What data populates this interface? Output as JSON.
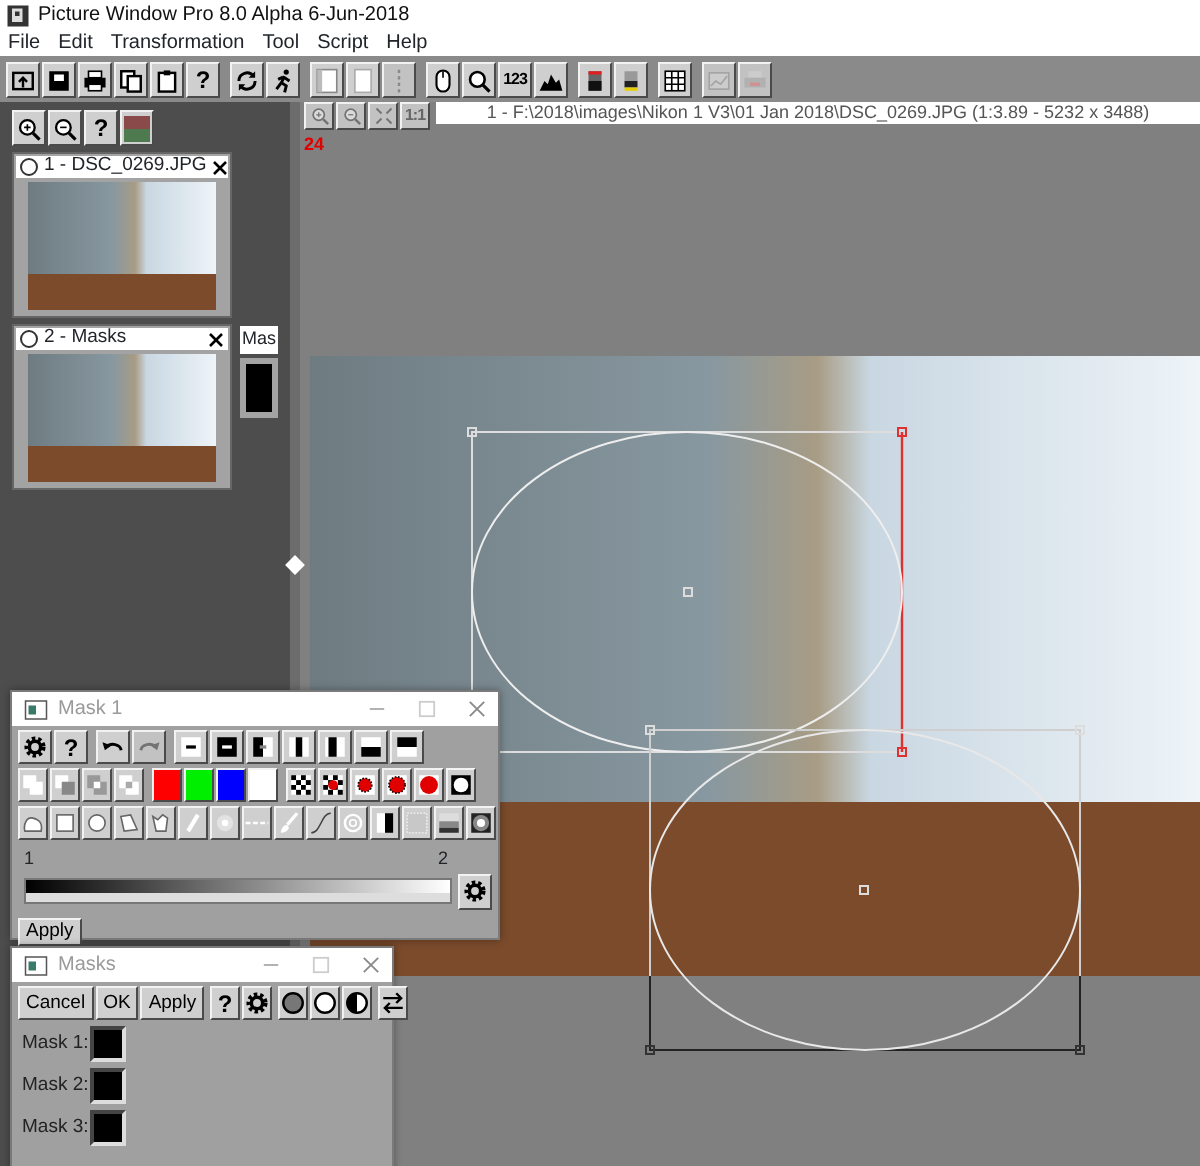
{
  "window": {
    "title": "Picture Window Pro 8.0 Alpha 6-Jun-2018"
  },
  "menu": [
    "File",
    "Edit",
    "Transformation",
    "Tool",
    "Script",
    "Help"
  ],
  "toolbar": [
    [
      {
        "kind": "open",
        "disabled": false
      },
      {
        "kind": "save",
        "disabled": false
      },
      {
        "kind": "print",
        "disabled": false
      },
      {
        "kind": "copy",
        "disabled": false
      },
      {
        "kind": "paste",
        "disabled": false
      },
      {
        "kind": "help",
        "label": "?",
        "disabled": false
      }
    ],
    [
      {
        "kind": "refresh",
        "disabled": false
      },
      {
        "kind": "run",
        "disabled": false
      }
    ],
    [
      {
        "kind": "panel-left",
        "disabled": false
      },
      {
        "kind": "page",
        "disabled": false
      },
      {
        "kind": "dots",
        "disabled": true
      }
    ],
    [
      {
        "kind": "mouse",
        "disabled": false
      },
      {
        "kind": "zoom",
        "disabled": false
      },
      {
        "kind": "numbers",
        "label": "123",
        "disabled": false
      },
      {
        "kind": "mountain",
        "disabled": false
      }
    ],
    [
      {
        "kind": "grad-red",
        "disabled": false
      },
      {
        "kind": "grad-yellow",
        "disabled": false
      }
    ],
    [
      {
        "kind": "grid",
        "disabled": false
      }
    ],
    [
      {
        "kind": "chart",
        "disabled": true
      },
      {
        "kind": "printer",
        "disabled": true
      }
    ]
  ],
  "panel": {
    "toolbar": [
      {
        "kind": "zoom-in",
        "disabled": false
      },
      {
        "kind": "zoom-out",
        "disabled": false
      },
      {
        "kind": "help",
        "label": "?",
        "disabled": false
      },
      {
        "kind": "swatch",
        "disabled": false
      }
    ],
    "thumbnails": [
      {
        "title": "1 - DSC_0269.JPG",
        "selected": false
      },
      {
        "title": "2 - Masks",
        "selected": false
      }
    ],
    "side_tab": {
      "label": "Mas"
    }
  },
  "image_window": {
    "toolbar": [
      {
        "kind": "zoom-in",
        "disabled": true
      },
      {
        "kind": "zoom-out",
        "disabled": true
      },
      {
        "kind": "fit",
        "disabled": true
      },
      {
        "kind": "actual-size",
        "label": "1:1",
        "disabled": true
      }
    ],
    "path": "1 - F:\\2018\\images\\Nikon 1 V3\\01 Jan 2018\\DSC_0269.JPG (1:3.89 - 5232 x 3488)",
    "counter": "24"
  },
  "mask_window": {
    "title": "Mask 1",
    "rows": [
      [
        [
          {
            "kind": "settings",
            "disabled": false
          },
          {
            "kind": "help",
            "label": "?",
            "disabled": false
          }
        ],
        [
          {
            "kind": "undo",
            "disabled": false
          },
          {
            "kind": "redo",
            "disabled": true
          }
        ],
        [
          {
            "kind": "dash",
            "disabled": false
          },
          {
            "kind": "dash-inverse",
            "disabled": false
          },
          {
            "kind": "split-dash",
            "disabled": false
          },
          {
            "kind": "bar-center",
            "disabled": false
          },
          {
            "kind": "bar-left",
            "disabled": false
          },
          {
            "kind": "band-bottom",
            "disabled": false
          },
          {
            "kind": "band-top",
            "disabled": false
          }
        ]
      ],
      [
        [
          {
            "kind": "union",
            "disabled": false
          },
          {
            "kind": "subtract",
            "disabled": false
          },
          {
            "kind": "intersect",
            "disabled": false
          },
          {
            "kind": "exclude",
            "disabled": false
          }
        ],
        [
          {
            "kind": "color",
            "color": "#ff0000"
          },
          {
            "kind": "color",
            "color": "#00ee00"
          },
          {
            "kind": "color",
            "color": "#0000ff"
          },
          {
            "kind": "color",
            "color": "#ffffff"
          }
        ],
        [
          {
            "kind": "checker",
            "disabled": false
          },
          {
            "kind": "checker-red",
            "disabled": false
          },
          {
            "kind": "dots-red-small",
            "disabled": false
          },
          {
            "kind": "dots-red",
            "disabled": false
          },
          {
            "kind": "dot-red",
            "disabled": false
          },
          {
            "kind": "dot-white",
            "disabled": false
          }
        ]
      ],
      [
        [
          {
            "kind": "blob",
            "disabled": false
          },
          {
            "kind": "square",
            "disabled": false
          },
          {
            "kind": "circle",
            "disabled": false
          },
          {
            "kind": "leaf",
            "disabled": false
          },
          {
            "kind": "cup",
            "disabled": false
          },
          {
            "kind": "stroke",
            "disabled": false
          },
          {
            "kind": "glow",
            "disabled": false
          },
          {
            "kind": "dashed",
            "disabled": false
          },
          {
            "kind": "brush",
            "disabled": false
          },
          {
            "kind": "curve",
            "disabled": false
          },
          {
            "kind": "swirl",
            "disabled": false
          },
          {
            "kind": "split",
            "disabled": false
          },
          {
            "kind": "noise",
            "disabled": false
          },
          {
            "kind": "gradient",
            "disabled": false
          },
          {
            "kind": "radial",
            "disabled": false
          }
        ]
      ]
    ],
    "scale": {
      "min": "1",
      "max": "2"
    },
    "apply": "Apply"
  },
  "masks_window": {
    "title": "Masks",
    "buttons": [
      [
        {
          "kind": "dialog",
          "label": "Cancel",
          "disabled": false
        },
        {
          "kind": "dialog",
          "label": "OK",
          "disabled": false
        },
        {
          "kind": "dialog",
          "label": "Apply",
          "disabled": false
        }
      ],
      [
        {
          "kind": "help",
          "label": "?",
          "disabled": false
        },
        {
          "kind": "settings",
          "disabled": false
        }
      ],
      [
        {
          "kind": "ring-dark",
          "disabled": false
        },
        {
          "kind": "ring-white",
          "disabled": false
        },
        {
          "kind": "ring-half",
          "disabled": false
        }
      ],
      [
        {
          "kind": "swap",
          "disabled": false
        }
      ]
    ],
    "masks": [
      {
        "label": "Mask 1:"
      },
      {
        "label": "Mask 2:"
      },
      {
        "label": "Mask 3:"
      }
    ]
  }
}
